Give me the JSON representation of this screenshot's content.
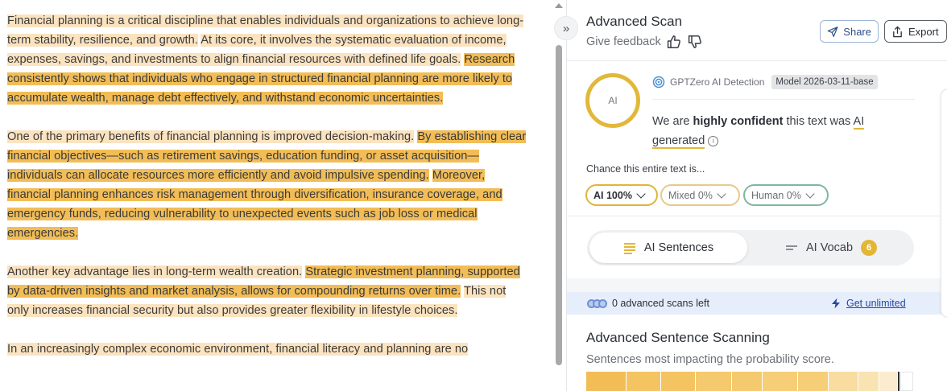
{
  "document": {
    "paragraphs": [
      [
        {
          "text": "Financial planning is a critical discipline that enables individuals and organizations to achieve long-term stability, resilience, and growth.",
          "level": "light"
        },
        {
          "text": " ",
          "level": "none"
        },
        {
          "text": "At its core, it involves the systematic evaluation of income, expenses, savings, and investments to align financial resources with defined life goals.",
          "level": "light"
        },
        {
          "text": " ",
          "level": "none"
        },
        {
          "text": "Research consistently shows that individuals who engage in structured financial planning are more likely to accumulate wealth, manage debt effectively, and withstand economic uncertainties.",
          "level": "strong"
        }
      ],
      [
        {
          "text": "One of the primary benefits of financial planning is improved decision-making.",
          "level": "light"
        },
        {
          "text": " ",
          "level": "none"
        },
        {
          "text": "By establishing clear financial objectives—such as retirement savings, education funding, or asset acquisition—individuals can allocate resources more efficiently and avoid impulsive spending.",
          "level": "strong"
        },
        {
          "text": " ",
          "level": "none"
        },
        {
          "text": "Moreover, financial planning enhances risk management through diversification, insurance coverage, and emergency funds, reducing vulnerability to unexpected events such as job loss or medical emergencies.",
          "level": "strong"
        }
      ],
      [
        {
          "text": "Another key advantage lies in long-term wealth creation.",
          "level": "light"
        },
        {
          "text": " ",
          "level": "none"
        },
        {
          "text": "Strategic investment planning, supported by data-driven insights and market analysis, allows for compounding returns over time.",
          "level": "strong"
        },
        {
          "text": " ",
          "level": "none"
        },
        {
          "text": "This not only increases financial security but also provides greater flexibility in lifestyle choices.",
          "level": "light"
        }
      ],
      [
        {
          "text": "In an increasingly complex economic environment, financial literacy and planning are no",
          "level": "light"
        }
      ]
    ]
  },
  "panel": {
    "title": "Advanced Scan",
    "feedback_label": "Give feedback",
    "share_label": "Share",
    "export_label": "Export"
  },
  "result": {
    "ring_label": "AI",
    "detector_name": "GPTZero AI Detection",
    "model_badge": "Model 2026-03-11-base",
    "confidence_prefix": "We are ",
    "confidence_strength": "highly confident",
    "confidence_middle": " this text was ",
    "confidence_result": "AI generated",
    "info_glyph": "i",
    "chance_label": "Chance this entire text is...",
    "pills": {
      "ai": "AI 100%",
      "mixed": "Mixed 0%",
      "human": "Human 0%"
    },
    "ai_probability": 1.0,
    "ring_color": "#e2b83a"
  },
  "tabs": {
    "sentences_label": "AI Sentences",
    "vocab_label": "AI Vocab",
    "vocab_count": "6"
  },
  "banner": {
    "scans_left": "0 advanced scans left",
    "get_unlimited": "Get unlimited"
  },
  "scanning": {
    "title": "Advanced Sentence Scanning",
    "subtitle": "Sentences most impacting the probability score.",
    "bar_colors": [
      "#f2bd57",
      "#f4c463",
      "#f4c463",
      "#f5c96d",
      "#f5c96d",
      "#f6ce78",
      "#f6ce78",
      "#f8dca0",
      "#f9e3b3",
      "#fbecd0",
      "#2b2f36",
      "#ffffff"
    ],
    "bar_weights": [
      55,
      47,
      47,
      50,
      42,
      48,
      42,
      40,
      28,
      25,
      2,
      18
    ]
  },
  "colors": {
    "highlight_light": "#fbe3c0",
    "highlight_strong": "#f2bd57",
    "accent_gold": "#e2b83a",
    "link_blue": "#2347a8"
  },
  "icons": {
    "collapse": "chevron-double-right-icon",
    "thumbs_up": "thumbs-up-icon",
    "thumbs_down": "thumbs-down-icon",
    "share": "send-icon",
    "export": "export-icon",
    "detector": "gptzero-logo-icon",
    "info": "info-icon",
    "sentences": "lines-icon",
    "vocab": "dash-lines-icon",
    "scans": "coins-icon",
    "unlimited": "lightning-icon"
  }
}
